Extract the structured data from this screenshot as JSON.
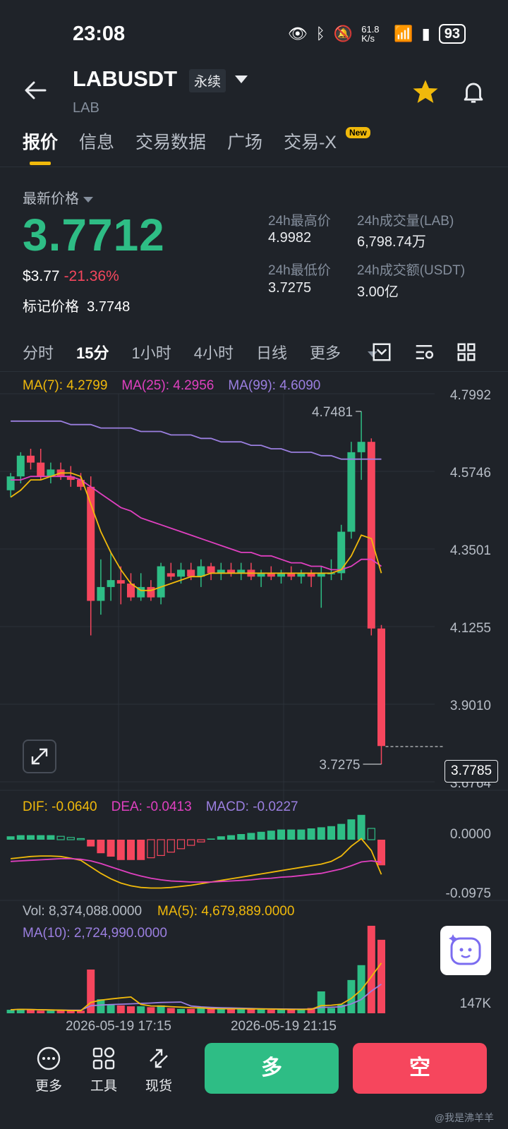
{
  "status_bar": {
    "time": "23:08",
    "net_speed": "61.8 K/s",
    "battery": "93"
  },
  "header": {
    "symbol": "LABUSDT",
    "contract_type": "永续",
    "base": "LAB"
  },
  "tabs": [
    {
      "label": "报价",
      "active": true
    },
    {
      "label": "信息"
    },
    {
      "label": "交易数据"
    },
    {
      "label": "广场"
    },
    {
      "label": "交易-X",
      "badge": "New"
    }
  ],
  "ticker": {
    "last_label": "最新价格",
    "last_price": "3.7712",
    "usd_price": "$3.77",
    "change_pct": "-21.36%",
    "mark_label": "标记价格",
    "mark_price": "3.7748",
    "high_label": "24h最高价",
    "high": "4.9982",
    "low_label": "24h最低价",
    "low": "3.7275",
    "vol_base_label": "24h成交量(LAB)",
    "vol_base": "6,798.74万",
    "vol_quote_label": "24h成交额(USDT)",
    "vol_quote": "3.00亿"
  },
  "timeframes": [
    "分时",
    "15分",
    "1小时",
    "4小时",
    "日线",
    "更多"
  ],
  "active_timeframe": "15分",
  "ma_legend": {
    "ma7": "MA(7): 4.2799",
    "ma25": "MA(25): 4.2956",
    "ma99": "MA(99): 4.6090"
  },
  "price_axis": [
    "4.7992",
    "4.5746",
    "4.3501",
    "4.1255",
    "3.9010",
    "3.6764"
  ],
  "annotations": {
    "high_mark": "4.7481",
    "low_mark": "3.7275",
    "current": "3.7785"
  },
  "macd_legend": {
    "dif": "DIF: -0.0640",
    "dea": "DEA: -0.0413",
    "macd": "MACD: -0.0227"
  },
  "macd_axis": [
    "0.0000",
    "-0.0975"
  ],
  "vol_legend": {
    "vol": "Vol: 8,374,088.0000",
    "ma5": "MA(5): 4,679,889.0000",
    "ma10": "MA(10): 2,724,990.0000"
  },
  "vol_axis": [
    "M",
    "147K"
  ],
  "time_axis": [
    "2026-05-19 17:15",
    "2026-05-19 21:15"
  ],
  "bottom": {
    "more": "更多",
    "tools": "工具",
    "spot": "现货",
    "long": "多",
    "short": "空"
  },
  "watermark": "@我是沸羊羊",
  "colors": {
    "up": "#2ebd85",
    "down": "#f6465d",
    "ma7": "#f0b90b",
    "ma25": "#e040c0",
    "ma99": "#9b7fe0",
    "accent": "#f0b90b"
  },
  "chart_data": {
    "type": "candlestick",
    "interval": "15m",
    "candles": [
      [
        4.52,
        4.57,
        4.5,
        4.56
      ],
      [
        4.56,
        4.63,
        4.54,
        4.62
      ],
      [
        4.62,
        4.64,
        4.58,
        4.6
      ],
      [
        4.6,
        4.64,
        4.55,
        4.56
      ],
      [
        4.56,
        4.6,
        4.54,
        4.58
      ],
      [
        4.58,
        4.6,
        4.55,
        4.56
      ],
      [
        4.56,
        4.59,
        4.53,
        4.55
      ],
      [
        4.55,
        4.57,
        4.52,
        4.53
      ],
      [
        4.53,
        4.56,
        4.1,
        4.2
      ],
      [
        4.2,
        4.32,
        4.16,
        4.24
      ],
      [
        4.24,
        4.34,
        4.2,
        4.26
      ],
      [
        4.26,
        4.3,
        4.19,
        4.25
      ],
      [
        4.25,
        4.28,
        4.2,
        4.21
      ],
      [
        4.21,
        4.28,
        4.2,
        4.24
      ],
      [
        4.24,
        4.26,
        4.2,
        4.21
      ],
      [
        4.21,
        4.31,
        4.19,
        4.3
      ],
      [
        4.28,
        4.31,
        4.26,
        4.27
      ],
      [
        4.27,
        4.31,
        4.25,
        4.29
      ],
      [
        4.29,
        4.31,
        4.26,
        4.27
      ],
      [
        4.27,
        4.32,
        4.24,
        4.3
      ],
      [
        4.3,
        4.31,
        4.26,
        4.28
      ],
      [
        4.28,
        4.31,
        4.26,
        4.29
      ],
      [
        4.29,
        4.31,
        4.27,
        4.28
      ],
      [
        4.28,
        4.31,
        4.26,
        4.29
      ],
      [
        4.29,
        4.31,
        4.26,
        4.27
      ],
      [
        4.27,
        4.29,
        4.24,
        4.28
      ],
      [
        4.28,
        4.3,
        4.26,
        4.27
      ],
      [
        4.27,
        4.29,
        4.25,
        4.28
      ],
      [
        4.28,
        4.3,
        4.26,
        4.27
      ],
      [
        4.27,
        4.29,
        4.25,
        4.28
      ],
      [
        4.28,
        4.29,
        4.24,
        4.27
      ],
      [
        4.27,
        4.3,
        4.18,
        4.28
      ],
      [
        4.28,
        4.32,
        4.26,
        4.28
      ],
      [
        4.28,
        4.42,
        4.26,
        4.4
      ],
      [
        4.4,
        4.66,
        4.38,
        4.63
      ],
      [
        4.63,
        4.7481,
        4.55,
        4.66
      ],
      [
        4.66,
        4.67,
        4.1,
        4.12
      ],
      [
        4.12,
        4.13,
        3.7275,
        3.78
      ]
    ],
    "ma7": [
      4.5,
      4.52,
      4.55,
      4.55,
      4.56,
      4.57,
      4.57,
      4.56,
      4.48,
      4.4,
      4.34,
      4.29,
      4.25,
      4.23,
      4.23,
      4.24,
      4.25,
      4.26,
      4.27,
      4.27,
      4.28,
      4.28,
      4.28,
      4.28,
      4.28,
      4.28,
      4.28,
      4.28,
      4.28,
      4.28,
      4.28,
      4.28,
      4.28,
      4.29,
      4.33,
      4.39,
      4.38,
      4.28
    ],
    "ma25": [
      4.55,
      4.55,
      4.56,
      4.56,
      4.56,
      4.56,
      4.56,
      4.55,
      4.53,
      4.51,
      4.49,
      4.47,
      4.46,
      4.44,
      4.43,
      4.42,
      4.41,
      4.4,
      4.39,
      4.38,
      4.37,
      4.36,
      4.35,
      4.34,
      4.34,
      4.33,
      4.33,
      4.32,
      4.31,
      4.31,
      4.3,
      4.3,
      4.29,
      4.29,
      4.3,
      4.32,
      4.32,
      4.3
    ],
    "ma99": [
      4.72,
      4.72,
      4.72,
      4.72,
      4.72,
      4.72,
      4.71,
      4.71,
      4.71,
      4.7,
      4.7,
      4.7,
      4.7,
      4.69,
      4.69,
      4.69,
      4.68,
      4.68,
      4.68,
      4.67,
      4.67,
      4.66,
      4.66,
      4.66,
      4.65,
      4.65,
      4.64,
      4.64,
      4.63,
      4.63,
      4.63,
      4.62,
      4.62,
      4.61,
      4.61,
      4.61,
      4.61,
      4.61
    ],
    "volume": [
      0.4,
      0.5,
      0.4,
      0.3,
      0.3,
      0.3,
      0.3,
      0.3,
      5.0,
      1.6,
      1.0,
      0.9,
      0.8,
      0.8,
      0.7,
      0.9,
      0.6,
      0.5,
      0.5,
      0.6,
      0.5,
      0.5,
      0.5,
      0.5,
      0.5,
      0.5,
      0.4,
      0.4,
      0.4,
      0.5,
      0.6,
      2.5,
      0.6,
      1.0,
      3.8,
      5.5,
      10.0,
      8.4
    ],
    "macd_hist": [
      0.003,
      0.004,
      0.004,
      0.004,
      0.004,
      0.003,
      0.002,
      0.001,
      -0.006,
      -0.012,
      -0.015,
      -0.018,
      -0.018,
      -0.018,
      -0.016,
      -0.014,
      -0.011,
      -0.008,
      -0.005,
      -0.002,
      0.001,
      0.003,
      0.004,
      0.005,
      0.006,
      0.007,
      0.008,
      0.009,
      0.009,
      0.009,
      0.01,
      0.011,
      0.012,
      0.014,
      0.018,
      0.022,
      0.01,
      -0.0227
    ],
    "dif": [
      -0.035,
      -0.033,
      -0.031,
      -0.03,
      -0.03,
      -0.031,
      -0.034,
      -0.038,
      -0.05,
      -0.062,
      -0.072,
      -0.08,
      -0.085,
      -0.088,
      -0.089,
      -0.089,
      -0.088,
      -0.086,
      -0.084,
      -0.081,
      -0.078,
      -0.075,
      -0.072,
      -0.069,
      -0.066,
      -0.063,
      -0.06,
      -0.057,
      -0.054,
      -0.051,
      -0.048,
      -0.045,
      -0.04,
      -0.03,
      -0.012,
      0.002,
      -0.02,
      -0.064
    ],
    "dea": [
      -0.04,
      -0.039,
      -0.038,
      -0.037,
      -0.036,
      -0.035,
      -0.035,
      -0.036,
      -0.039,
      -0.044,
      -0.05,
      -0.056,
      -0.062,
      -0.067,
      -0.071,
      -0.074,
      -0.076,
      -0.077,
      -0.078,
      -0.078,
      -0.078,
      -0.077,
      -0.076,
      -0.075,
      -0.074,
      -0.072,
      -0.071,
      -0.069,
      -0.068,
      -0.066,
      -0.064,
      -0.062,
      -0.058,
      -0.054,
      -0.048,
      -0.041,
      -0.039,
      -0.0413
    ],
    "price_range": [
      3.6764,
      4.7992
    ]
  }
}
